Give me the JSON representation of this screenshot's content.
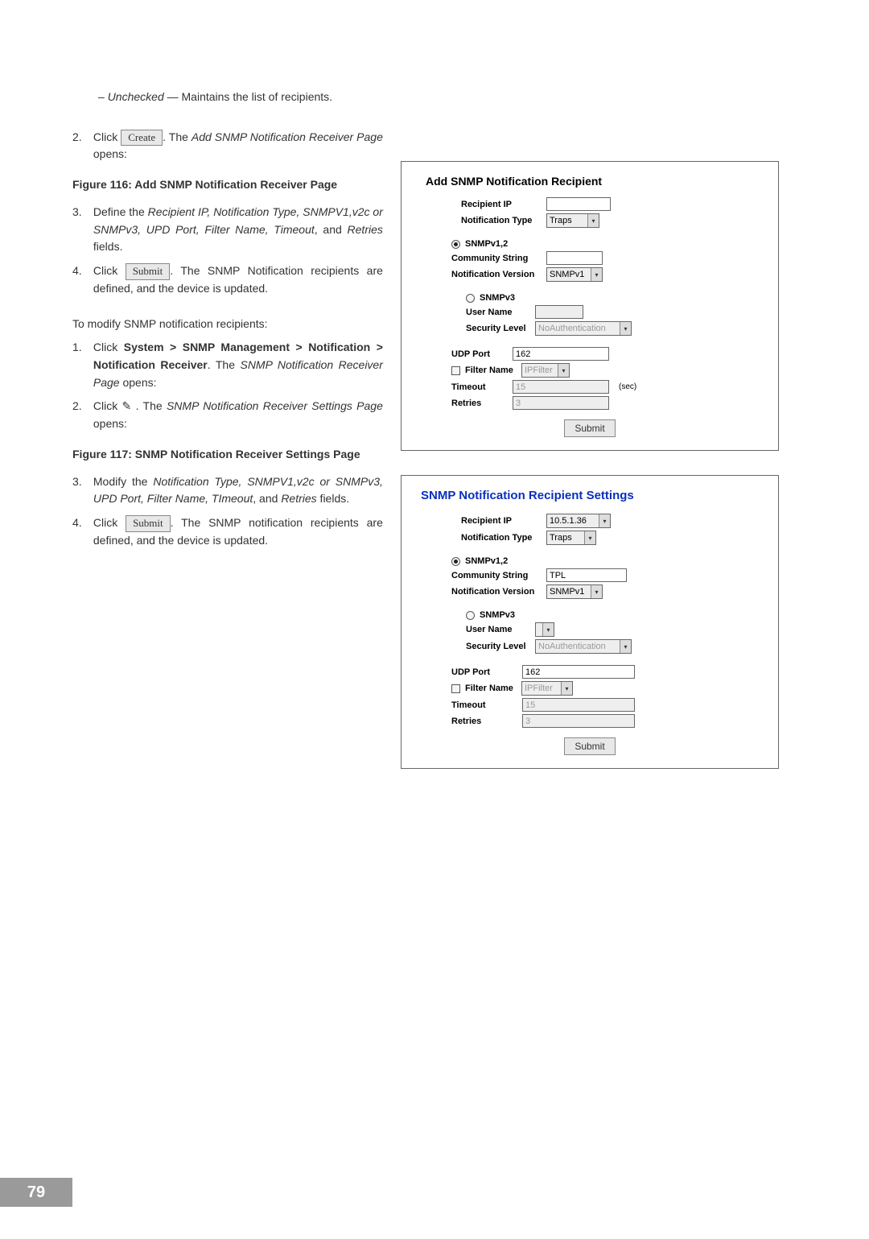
{
  "page_number": "79",
  "left": {
    "dash_item": {
      "term": "Unchecked",
      "desc": " — Maintains the list of recipients."
    },
    "step2a": {
      "num": "2.",
      "pre": "Click ",
      "btn": "Create",
      "post": ". The ",
      "italic": "Add SNMP Notification Receiver Page",
      "tail": " opens:"
    },
    "fig116": "Figure 116: Add SNMP Notification Receiver Page",
    "step3a": {
      "num": "3.",
      "pre": "Define the ",
      "italic": "Recipient IP, Notification Type, SNMPV1,v2c or SNMPv3, UPD Port, Filter Name, Timeout",
      "mid": ", and ",
      "italic2": "Retries",
      "tail": " fields."
    },
    "step4a": {
      "num": "4.",
      "pre": "Click ",
      "btn": "Submit",
      "post": ". The SNMP Notification recipients are defined, and the device is updated."
    },
    "modify_intro": "To modify SNMP notification recipients:",
    "step1b": {
      "num": "1.",
      "pre": "Click ",
      "bold": "System > SNMP Management > Notification > Notification Receiver",
      "post": ". The ",
      "italic": "SNMP Notification Receiver Page",
      "tail": " opens:"
    },
    "step2b": {
      "num": "2.",
      "pre": "Click ",
      "iconname": "pencil-icon",
      "icon": "✎",
      "post": " . The ",
      "italic": "SNMP Notification Receiver Settings Page",
      "tail": " opens:"
    },
    "fig117": "Figure 117: SNMP Notification Receiver Settings Page",
    "step3b": {
      "num": "3.",
      "pre": "Modify the ",
      "italic": "Notification Type, SNMPV1,v2c or SNMPv3, UPD Port, Filter Name, TImeout",
      "mid": ", and ",
      "italic2": "Retries",
      "tail": " fields."
    },
    "step4b": {
      "num": "4.",
      "pre": "Click ",
      "btn": "Submit",
      "post": ". The SNMP notification recipients are defined, and the device is updated."
    }
  },
  "panel1": {
    "title": "Add SNMP Notification Recipient",
    "recipient_ip_label": "Recipient IP",
    "recipient_ip_value": "",
    "notif_type_label": "Notification Type",
    "notif_type_value": "Traps",
    "snmp12_label": "SNMPv1,2",
    "community_label": "Community String",
    "community_value": "",
    "notif_ver_label": "Notification Version",
    "notif_ver_value": "SNMPv1",
    "snmp3_label": "SNMPv3",
    "user_name_label": "User Name",
    "user_name_value": "",
    "sec_level_label": "Security Level",
    "sec_level_value": "NoAuthentication",
    "udp_port_label": "UDP Port",
    "udp_port_value": "162",
    "filter_name_label": "Filter Name",
    "filter_name_value": "IPFilter",
    "timeout_label": "Timeout",
    "timeout_value": "15",
    "timeout_unit": "(sec)",
    "retries_label": "Retries",
    "retries_value": "3",
    "submit": "Submit"
  },
  "panel2": {
    "title": "SNMP Notification Recipient Settings",
    "recipient_ip_label": "Recipient IP",
    "recipient_ip_value": "10.5.1.36",
    "notif_type_label": "Notification Type",
    "notif_type_value": "Traps",
    "snmp12_label": "SNMPv1,2",
    "community_label": "Community String",
    "community_value": "TPL",
    "notif_ver_label": "Notification Version",
    "notif_ver_value": "SNMPv1",
    "snmp3_label": "SNMPv3",
    "user_name_label": "User Name",
    "sec_level_label": "Security Level",
    "sec_level_value": "NoAuthentication",
    "udp_port_label": "UDP Port",
    "udp_port_value": "162",
    "filter_name_label": "Filter Name",
    "filter_name_value": "IPFilter",
    "timeout_label": "Timeout",
    "timeout_value": "15",
    "retries_label": "Retries",
    "retries_value": "3",
    "submit": "Submit"
  }
}
